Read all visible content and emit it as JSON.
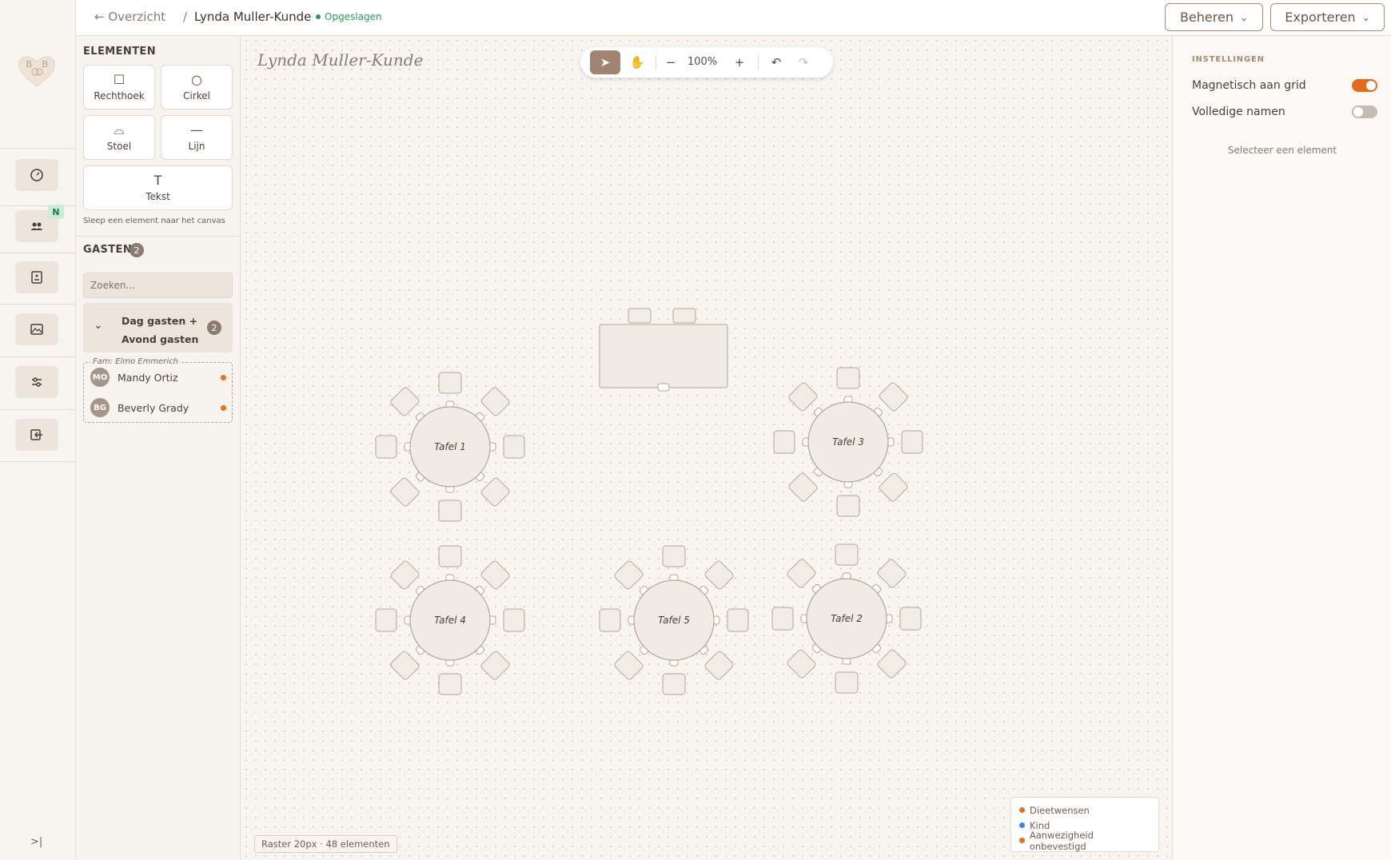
{
  "nav": {
    "logo_text": "B B",
    "new_badge": "N",
    "items": [
      {
        "icon": "gauge-icon"
      },
      {
        "icon": "users-icon"
      },
      {
        "icon": "document-icon"
      },
      {
        "icon": "gallery-icon"
      },
      {
        "icon": "sliders-icon"
      },
      {
        "icon": "logout-icon"
      }
    ],
    "collapse_label": ">|"
  },
  "header": {
    "back_label": "← Overzicht",
    "separator": "/",
    "title": "Lynda Muller-Kunde",
    "status": "Opgeslagen",
    "manage_label": "Beheren",
    "export_label": "Exporteren"
  },
  "elements": {
    "title": "ELEMENTEN",
    "tools": [
      {
        "label": "Rechthoek",
        "glyph": "☐"
      },
      {
        "label": "Cirkel",
        "glyph": "○"
      },
      {
        "label": "Stoel",
        "glyph": "⌓"
      },
      {
        "label": "Lijn",
        "glyph": "—"
      },
      {
        "label": "Tekst",
        "glyph": "T"
      }
    ],
    "hint": "Sleep een element naar het canvas"
  },
  "guests": {
    "title": "GASTEN",
    "count": "2",
    "search_placeholder": "Zoeken...",
    "group": {
      "label": "Dag gasten + Avond gasten",
      "count": "2"
    },
    "family_label": "Fam: Elmo Emmerich",
    "members": [
      {
        "initials": "MO",
        "name": "Mandy Ortiz"
      },
      {
        "initials": "BG",
        "name": "Beverly Grady"
      }
    ]
  },
  "canvas": {
    "title": "Lynda Muller-Kunde",
    "zoom": "100%",
    "tables": [
      {
        "label": "Tafel 1"
      },
      {
        "label": "Tafel 3"
      },
      {
        "label": "Tafel 4"
      },
      {
        "label": "Tafel 5"
      },
      {
        "label": "Tafel 2"
      }
    ],
    "status_text": "Raster 20px · 48 elementen",
    "legend": [
      {
        "label": "Dieetwensen",
        "color": "#e8701f"
      },
      {
        "label": "Kind",
        "color": "#3b82f6"
      },
      {
        "label": "Aanwezigheid onbevestigd",
        "color": "#e8701f"
      }
    ]
  },
  "settings": {
    "title": "INSTELLINGEN",
    "snap_label": "Magnetisch aan grid",
    "snap_on": true,
    "fullnames_label": "Volledige namen",
    "fullnames_on": false,
    "empty_text": "Selecteer een element"
  }
}
